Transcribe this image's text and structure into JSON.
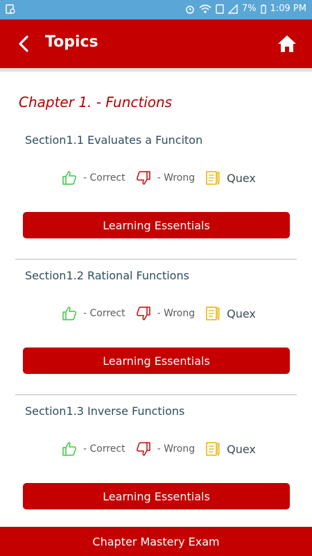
{
  "status_bar": {
    "battery": "7%",
    "time": "1:09 PM"
  },
  "app_bar": {
    "title": "Topics"
  },
  "chapter": {
    "title": "Chapter 1. - Functions"
  },
  "sections": [
    {
      "title": "Section1.1 Evaluates a Funciton",
      "correct_label": "- Correct",
      "wrong_label": "- Wrong",
      "quex_label": "Quex",
      "button_label": "Learning Essentials"
    },
    {
      "title": "Section1.2 Rational Functions",
      "correct_label": "- Correct",
      "wrong_label": "- Wrong",
      "quex_label": "Quex",
      "button_label": "Learning Essentials"
    },
    {
      "title": "Section1.3 Inverse Functions",
      "correct_label": "- Correct",
      "wrong_label": "- Wrong",
      "quex_label": "Quex",
      "button_label": "Learning Essentials"
    }
  ],
  "bottom_bar": {
    "label": "Chapter Mastery Exam"
  },
  "colors": {
    "primary": "#c40000",
    "status_bar": "#5aa6d6",
    "correct": "#3cc83c",
    "wrong": "#d40000",
    "quex": "#e6b400"
  },
  "icons": [
    "thumbs-up-icon",
    "thumbs-down-icon",
    "notepad-icon",
    "back-arrow-icon",
    "home-icon"
  ]
}
